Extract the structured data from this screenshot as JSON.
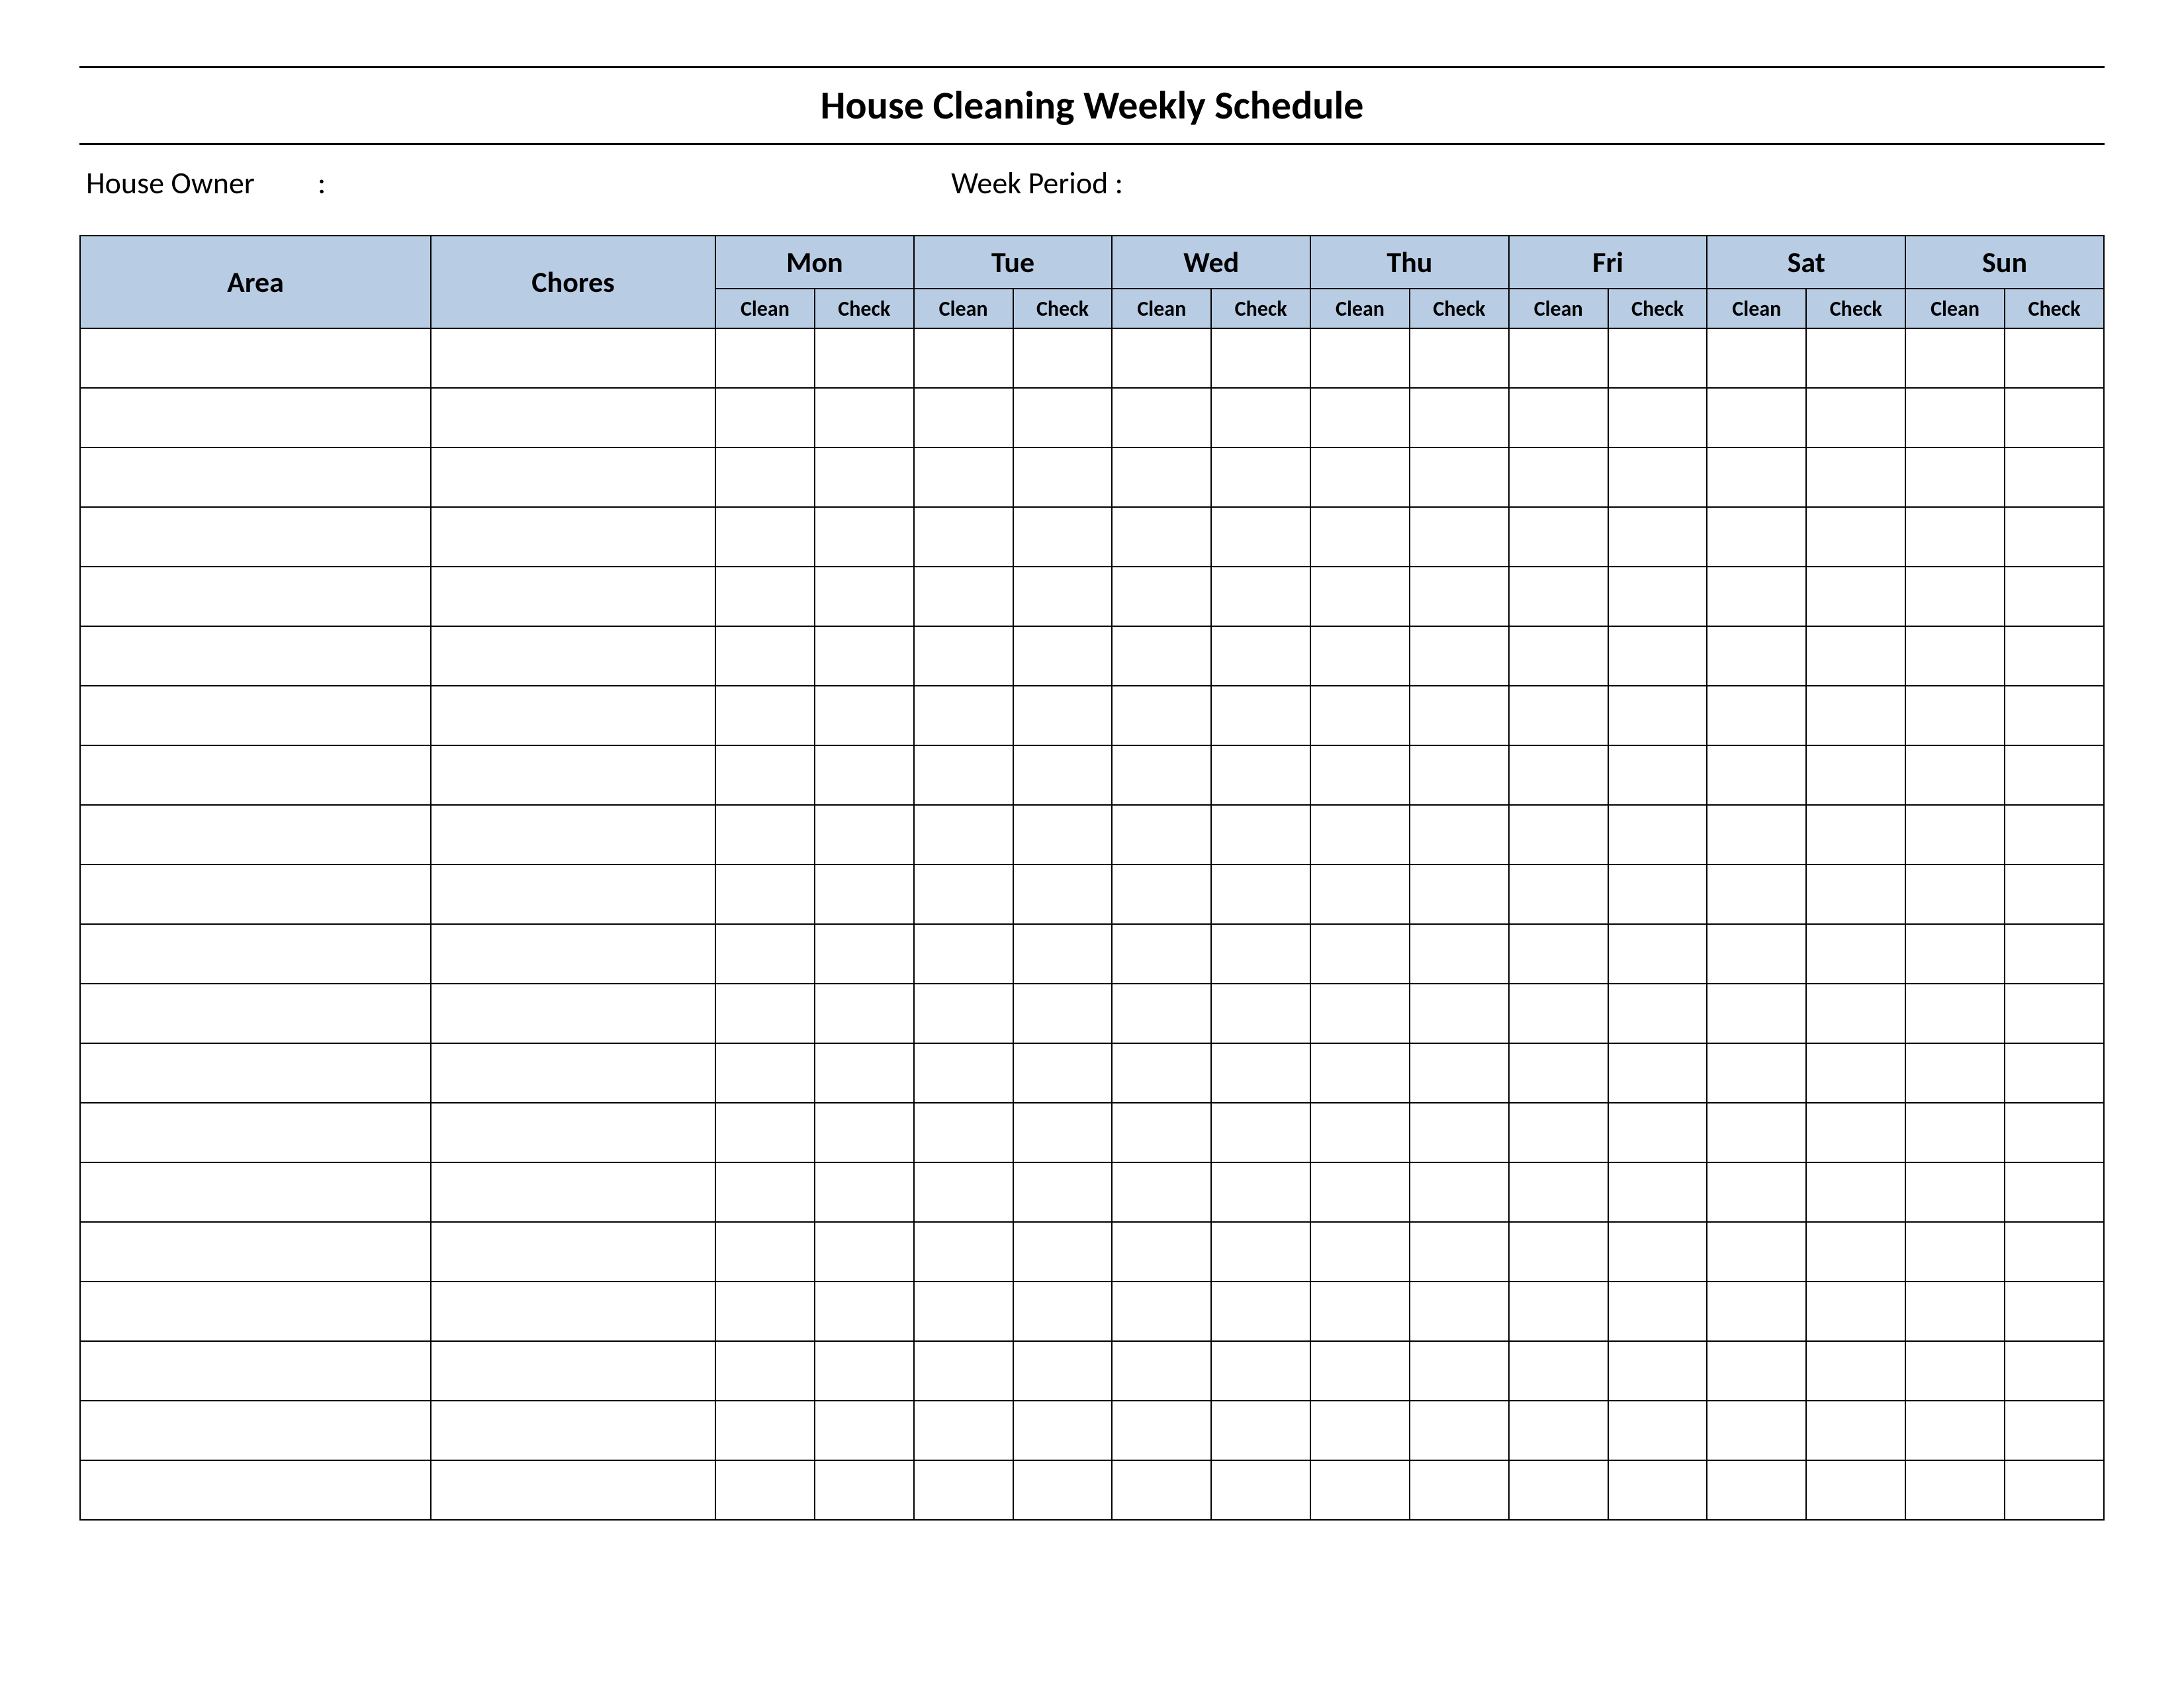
{
  "title": "House Cleaning Weekly Schedule",
  "meta": {
    "owner_label": "House Owner",
    "owner_value": "",
    "period_label": "Week  Period :",
    "period_value": ""
  },
  "table": {
    "headers": {
      "area": "Area",
      "chores": "Chores",
      "days": [
        "Mon",
        "Tue",
        "Wed",
        "Thu",
        "Fri",
        "Sat",
        "Sun"
      ],
      "sub": [
        "Clean",
        "Check"
      ]
    },
    "row_count": 20
  }
}
